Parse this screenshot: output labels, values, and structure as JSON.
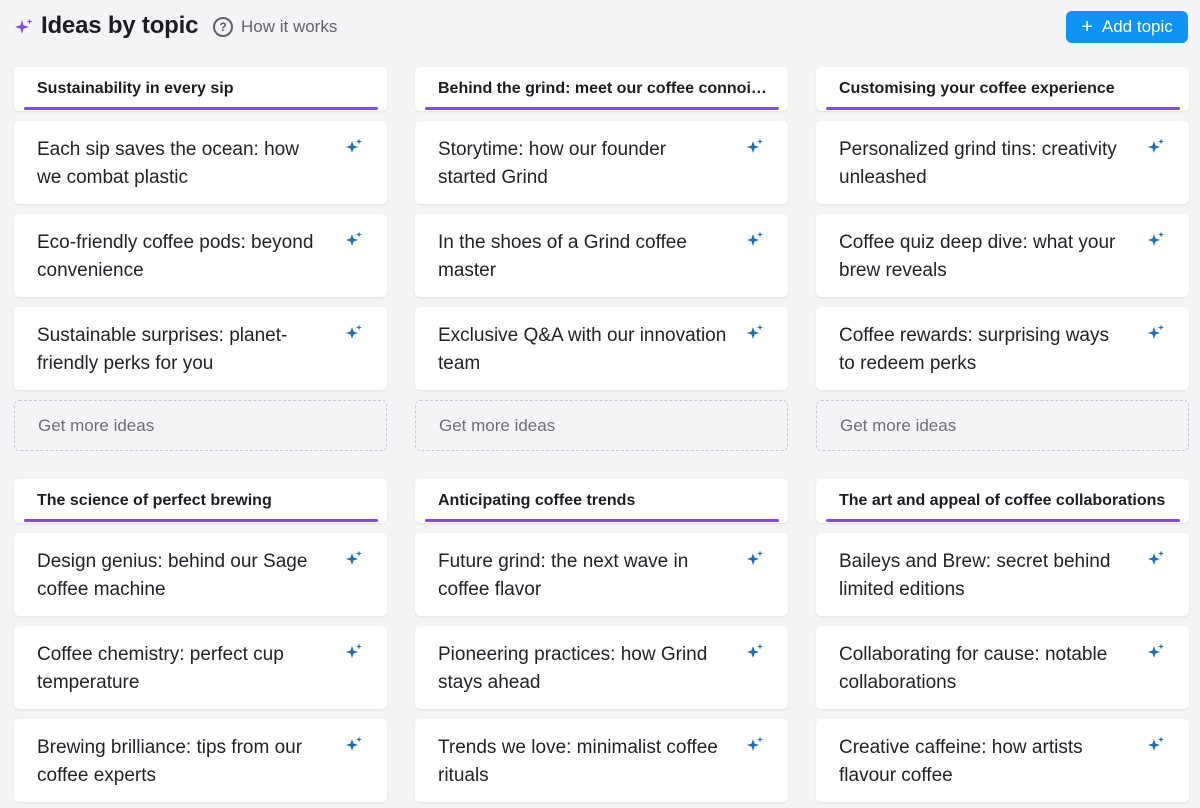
{
  "header": {
    "title": "Ideas by topic",
    "how_it_works_label": "How it works",
    "add_topic_label": "Add topic",
    "accent_color": "#8649e1",
    "button_color": "#0d93f3",
    "sparkle_color": "#1b6fb5"
  },
  "topics": [
    {
      "title": "Sustainability in every sip",
      "ideas": [
        "Each sip saves the ocean: how we combat plastic",
        "Eco-friendly coffee pods: beyond convenience",
        "Sustainable surprises: planet-friendly perks for you"
      ],
      "more_label": "Get more ideas"
    },
    {
      "title": "Behind the grind: meet our coffee connoisseurs",
      "ideas": [
        "Storytime: how our founder started Grind",
        "In the shoes of a Grind coffee master",
        "Exclusive Q&A with our innovation team"
      ],
      "more_label": "Get more ideas"
    },
    {
      "title": "Customising your coffee experience",
      "ideas": [
        "Personalized grind tins: creativity unleashed",
        "Coffee quiz deep dive: what your brew reveals",
        "Coffee rewards: surprising ways to redeem perks"
      ],
      "more_label": "Get more ideas"
    },
    {
      "title": "The science of perfect brewing",
      "ideas": [
        "Design genius: behind our Sage coffee machine",
        "Coffee chemistry: perfect cup temperature",
        "Brewing brilliance: tips from our coffee experts"
      ]
    },
    {
      "title": "Anticipating coffee trends",
      "ideas": [
        "Future grind: the next wave in coffee flavor",
        "Pioneering practices: how Grind stays ahead",
        "Trends we love: minimalist coffee rituals"
      ]
    },
    {
      "title": "The art and appeal of coffee collaborations",
      "ideas": [
        "Baileys and Brew: secret behind limited editions",
        "Collaborating for cause: notable collaborations",
        "Creative caffeine: how artists flavour coffee"
      ]
    }
  ]
}
